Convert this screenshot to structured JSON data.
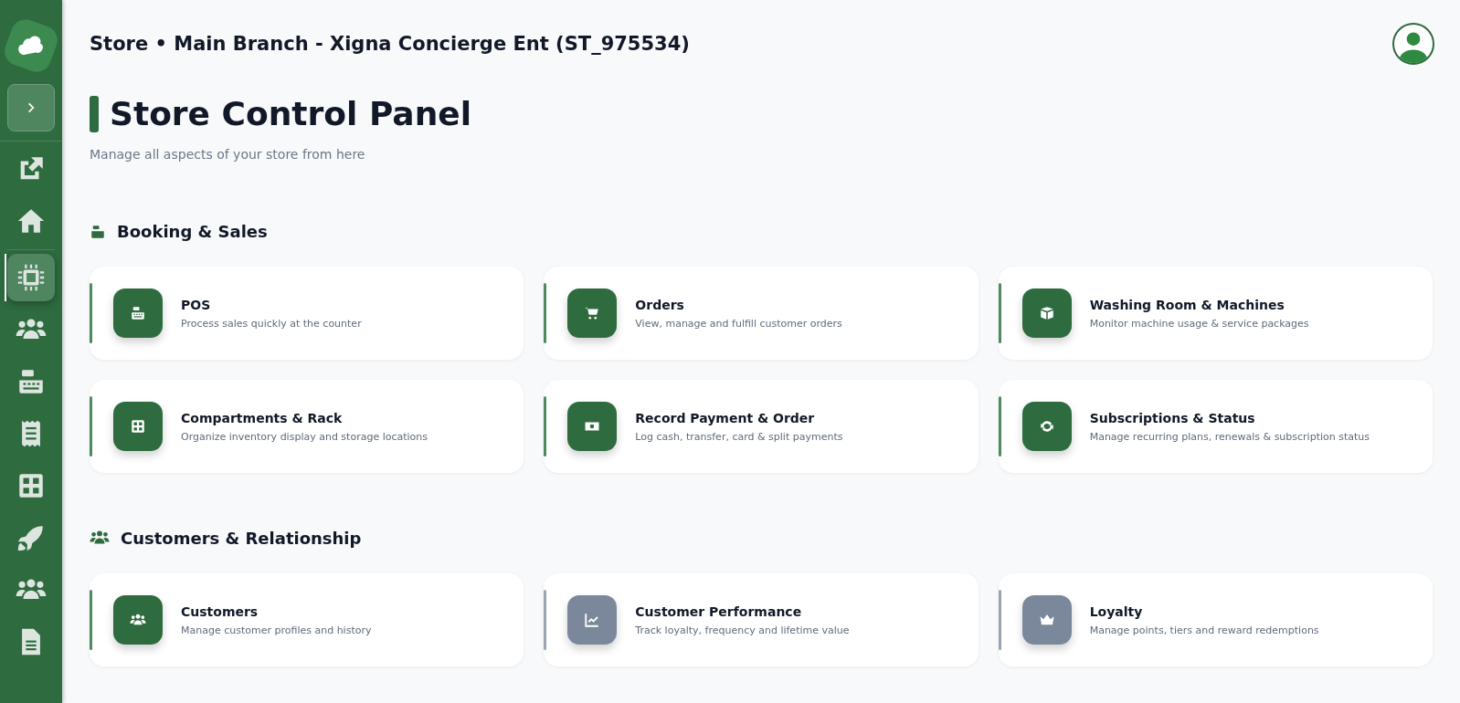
{
  "sidebar": {
    "items": [
      {
        "kind": "external",
        "selected": false
      },
      {
        "kind": "home",
        "selected": false
      },
      {
        "kind": "chip",
        "selected": true
      },
      {
        "kind": "users",
        "selected": false
      },
      {
        "kind": "register",
        "selected": false
      },
      {
        "kind": "receipt",
        "selected": false
      },
      {
        "kind": "grid",
        "selected": false
      },
      {
        "kind": "rocket",
        "selected": false
      },
      {
        "kind": "users",
        "selected": false
      },
      {
        "kind": "document",
        "selected": false
      }
    ]
  },
  "header": {
    "title": "Store • Main Branch - Xigna Concierge Ent (ST_975534)"
  },
  "page": {
    "title": "Store Control Panel",
    "subtitle": "Manage all aspects of your store from here"
  },
  "sections": [
    {
      "title": "Booking & Sales",
      "kind": "register",
      "cards": [
        {
          "title": "POS",
          "description": "Process sales quickly at the counter",
          "kind": "register",
          "disabled": false
        },
        {
          "title": "Orders",
          "description": "View, manage and fulfill customer orders",
          "kind": "cart",
          "disabled": false
        },
        {
          "title": "Washing Room & Machines",
          "description": "Monitor machine usage & service packages",
          "kind": "box",
          "disabled": false
        },
        {
          "title": "Compartments & Rack",
          "description": "Organize inventory display and storage locations",
          "kind": "grid",
          "disabled": false
        },
        {
          "title": "Record Payment & Order",
          "description": "Log cash, transfer, card & split payments",
          "kind": "money",
          "disabled": false
        },
        {
          "title": "Subscriptions & Status",
          "description": "Manage recurring plans, renewals & subscription status",
          "kind": "sync",
          "disabled": false
        }
      ]
    },
    {
      "title": "Customers & Relationship",
      "kind": "users",
      "cards": [
        {
          "title": "Customers",
          "description": "Manage customer profiles and history",
          "kind": "users",
          "disabled": false
        },
        {
          "title": "Customer Performance",
          "description": "Track loyalty, frequency and lifetime value",
          "kind": "chart",
          "disabled": true
        },
        {
          "title": "Loyalty",
          "description": "Manage points, tiers and reward redemptions",
          "kind": "crown",
          "disabled": true
        }
      ]
    }
  ]
}
